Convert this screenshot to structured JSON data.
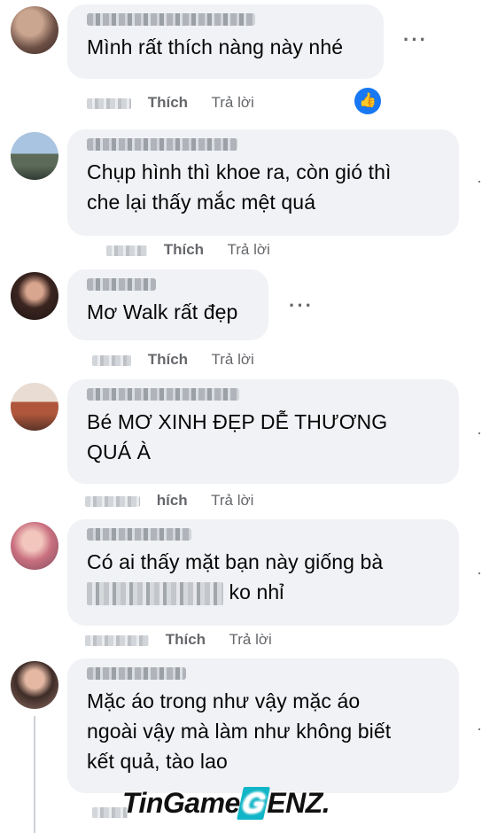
{
  "actions": {
    "like_label": "Thích",
    "reply_label": "Trả lời",
    "like_label_alt": "hích"
  },
  "watermark": {
    "part1": "TinGame",
    "part2": "G",
    "part3": "ENZ."
  },
  "comments": [
    {
      "text": "Mình rất thích nàng này nhé",
      "avatar_color": "#8a6c5e"
    },
    {
      "text_line1": "Chụp hình thì khoe ra, còn gió thì",
      "text_line2": "che lại thấy mắc mệt quá",
      "avatar_color": "#7f95b0"
    },
    {
      "text": "Mơ Walk rất đẹp",
      "avatar_color": "#7a4a3a"
    },
    {
      "text_line1": "Bé MƠ XINH ĐẸP DỄ THƯƠNG",
      "text_line2": "QUÁ À",
      "avatar_color": "#a1674f"
    },
    {
      "text_line1a": "Có ai thấy mặt bạn này giống bà",
      "text_line2_suffix": "ko nhỉ",
      "avatar_color": "#d68e9a"
    },
    {
      "text_line1": "Mặc áo trong như vậy mặc áo",
      "text_line2": "ngoài vậy mà làm như không biết",
      "text_line3": "kết quả, tào lao",
      "avatar_color": "#6b5a52"
    }
  ],
  "more_glyph": "···",
  "react_glyph": "👍"
}
